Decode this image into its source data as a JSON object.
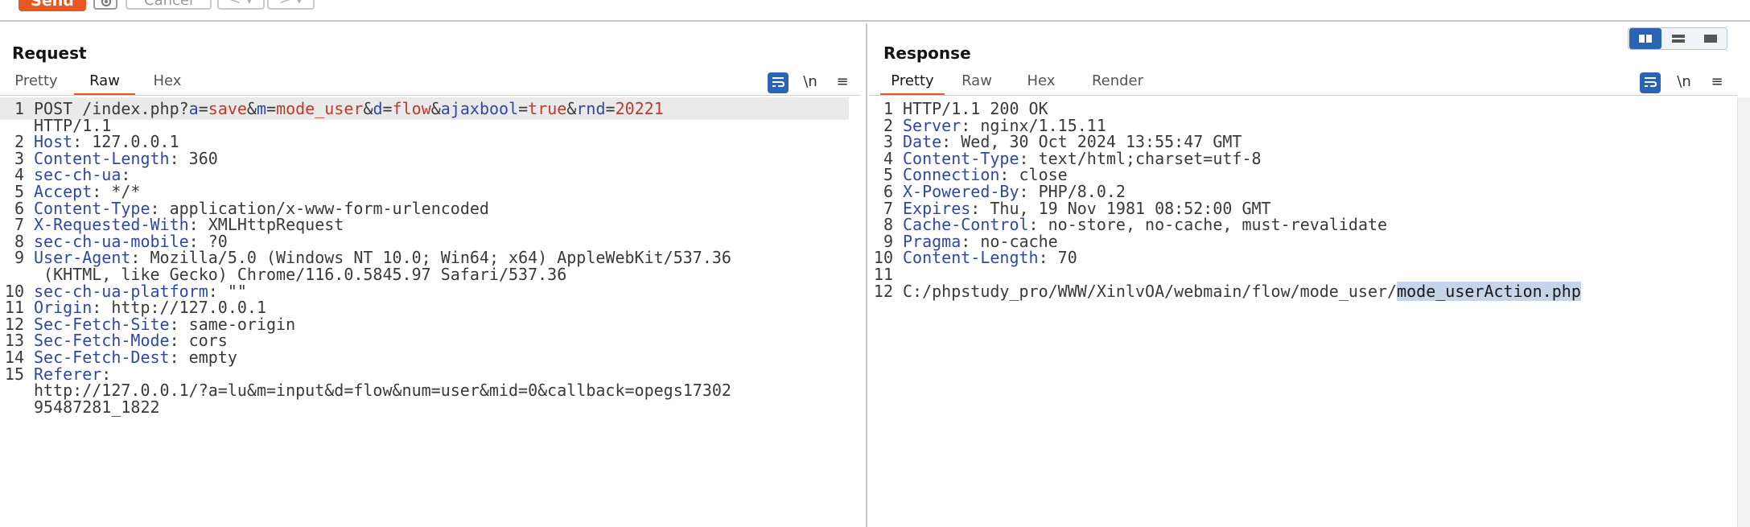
{
  "toolbar": {
    "send_label": "Send",
    "cancel_label": "Cancel",
    "prev_label": "< ▾",
    "next_label": "> ▾"
  },
  "request": {
    "title": "Request",
    "tabs": [
      "Pretty",
      "Raw",
      "Hex"
    ],
    "active_tab": "Raw",
    "newline_icon_label": "\\n",
    "lines": [
      {
        "n": "1",
        "parts": [
          {
            "t": "POST /index.php?",
            "c": "v"
          },
          {
            "t": "a",
            "c": "k"
          },
          {
            "t": "=",
            "c": "v"
          },
          {
            "t": "save",
            "c": "pv"
          },
          {
            "t": "&",
            "c": "v"
          },
          {
            "t": "m",
            "c": "k"
          },
          {
            "t": "=",
            "c": "v"
          },
          {
            "t": "mode_user",
            "c": "pv"
          },
          {
            "t": "&",
            "c": "v"
          },
          {
            "t": "d",
            "c": "k"
          },
          {
            "t": "=",
            "c": "v"
          },
          {
            "t": "flow",
            "c": "pv"
          },
          {
            "t": "&",
            "c": "v"
          },
          {
            "t": "ajaxbool",
            "c": "k"
          },
          {
            "t": "=",
            "c": "v"
          },
          {
            "t": "true",
            "c": "pv"
          },
          {
            "t": "&",
            "c": "v"
          },
          {
            "t": "rnd",
            "c": "k"
          },
          {
            "t": "=",
            "c": "v"
          },
          {
            "t": "20221",
            "c": "pv"
          }
        ]
      },
      {
        "n": "",
        "parts": [
          {
            "t": "HTTP/1.1",
            "c": "v"
          }
        ]
      },
      {
        "n": "2",
        "parts": [
          {
            "t": "Host",
            "c": "k"
          },
          {
            "t": ": 127.0.0.1",
            "c": "v"
          }
        ]
      },
      {
        "n": "3",
        "parts": [
          {
            "t": "Content-Length",
            "c": "k"
          },
          {
            "t": ": 360",
            "c": "v"
          }
        ]
      },
      {
        "n": "4",
        "parts": [
          {
            "t": "sec-ch-ua",
            "c": "k"
          },
          {
            "t": ":",
            "c": "v"
          }
        ]
      },
      {
        "n": "5",
        "parts": [
          {
            "t": "Accept",
            "c": "k"
          },
          {
            "t": ": */*",
            "c": "v"
          }
        ]
      },
      {
        "n": "6",
        "parts": [
          {
            "t": "Content-Type",
            "c": "k"
          },
          {
            "t": ": application/x-www-form-urlencoded",
            "c": "v"
          }
        ]
      },
      {
        "n": "7",
        "parts": [
          {
            "t": "X-Requested-With",
            "c": "k"
          },
          {
            "t": ": XMLHttpRequest",
            "c": "v"
          }
        ]
      },
      {
        "n": "8",
        "parts": [
          {
            "t": "sec-ch-ua-mobile",
            "c": "k"
          },
          {
            "t": ": ?0",
            "c": "v"
          }
        ]
      },
      {
        "n": "9",
        "parts": [
          {
            "t": "User-Agent",
            "c": "k"
          },
          {
            "t": ": Mozilla/5.0 (Windows NT 10.0; Win64; x64) AppleWebKit/537.36",
            "c": "v"
          }
        ]
      },
      {
        "n": "",
        "parts": [
          {
            "t": " (KHTML, like Gecko) Chrome/116.0.5845.97 Safari/537.36",
            "c": "v"
          }
        ]
      },
      {
        "n": "10",
        "parts": [
          {
            "t": "sec-ch-ua-platform",
            "c": "k"
          },
          {
            "t": ": \"\"",
            "c": "v"
          }
        ]
      },
      {
        "n": "11",
        "parts": [
          {
            "t": "Origin",
            "c": "k"
          },
          {
            "t": ": http://127.0.0.1",
            "c": "v"
          }
        ]
      },
      {
        "n": "12",
        "parts": [
          {
            "t": "Sec-Fetch-Site",
            "c": "k"
          },
          {
            "t": ": same-origin",
            "c": "v"
          }
        ]
      },
      {
        "n": "13",
        "parts": [
          {
            "t": "Sec-Fetch-Mode",
            "c": "k"
          },
          {
            "t": ": cors",
            "c": "v"
          }
        ]
      },
      {
        "n": "14",
        "parts": [
          {
            "t": "Sec-Fetch-Dest",
            "c": "k"
          },
          {
            "t": ": empty",
            "c": "v"
          }
        ]
      },
      {
        "n": "15",
        "parts": [
          {
            "t": "Referer",
            "c": "k"
          },
          {
            "t": ":",
            "c": "v"
          }
        ]
      },
      {
        "n": "",
        "parts": [
          {
            "t": "http://127.0.0.1/?a=lu&m=input&d=flow&num=user&mid=0&callback=opegs17302",
            "c": "v"
          }
        ]
      },
      {
        "n": "",
        "parts": [
          {
            "t": "95487281_1822",
            "c": "v"
          }
        ]
      }
    ]
  },
  "response": {
    "title": "Response",
    "tabs": [
      "Pretty",
      "Raw",
      "Hex",
      "Render"
    ],
    "active_tab": "Pretty",
    "newline_icon_label": "\\n",
    "lines": [
      {
        "n": "1",
        "parts": [
          {
            "t": "HTTP/1.1 200 OK",
            "c": "v"
          }
        ]
      },
      {
        "n": "2",
        "parts": [
          {
            "t": "Server",
            "c": "k"
          },
          {
            "t": ": nginx/1.15.11",
            "c": "v"
          }
        ]
      },
      {
        "n": "3",
        "parts": [
          {
            "t": "Date",
            "c": "k"
          },
          {
            "t": ": Wed, 30 Oct 2024 13:55:47 GMT",
            "c": "v"
          }
        ]
      },
      {
        "n": "4",
        "parts": [
          {
            "t": "Content-Type",
            "c": "k"
          },
          {
            "t": ": text/html;charset=utf-8",
            "c": "v"
          }
        ]
      },
      {
        "n": "5",
        "parts": [
          {
            "t": "Connection",
            "c": "k"
          },
          {
            "t": ": close",
            "c": "v"
          }
        ]
      },
      {
        "n": "6",
        "parts": [
          {
            "t": "X-Powered-By",
            "c": "k"
          },
          {
            "t": ": PHP/8.0.2",
            "c": "v"
          }
        ]
      },
      {
        "n": "7",
        "parts": [
          {
            "t": "Expires",
            "c": "k"
          },
          {
            "t": ": Thu, 19 Nov 1981 08:52:00 GMT",
            "c": "v"
          }
        ]
      },
      {
        "n": "8",
        "parts": [
          {
            "t": "Cache-Control",
            "c": "k"
          },
          {
            "t": ": no-store, no-cache, must-revalidate",
            "c": "v"
          }
        ]
      },
      {
        "n": "9",
        "parts": [
          {
            "t": "Pragma",
            "c": "k"
          },
          {
            "t": ": no-cache",
            "c": "v"
          }
        ]
      },
      {
        "n": "10",
        "parts": [
          {
            "t": "Content-Length",
            "c": "k"
          },
          {
            "t": ": 70",
            "c": "v"
          }
        ]
      },
      {
        "n": "11",
        "parts": []
      },
      {
        "n": "12",
        "parts": [
          {
            "t": "C:/phpstudy_pro/WWW/XinlvOA/webmain/flow/mode_user/",
            "c": "v"
          },
          {
            "t": "mode_userAction.php",
            "c": "sel"
          }
        ]
      }
    ]
  },
  "colors": {
    "accent": "#e8571f",
    "header_key": "#2f48a5",
    "param_value": "#c0392b",
    "active_icon": "#2b63b5"
  }
}
